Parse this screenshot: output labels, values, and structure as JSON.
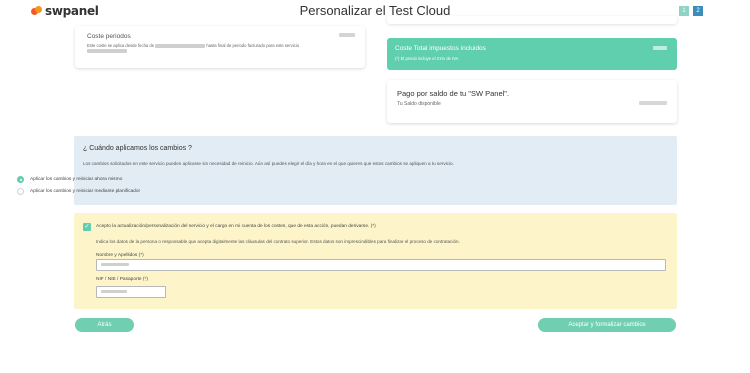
{
  "header": {
    "logo_text": "swpanel",
    "title": "Personalizar el Test Cloud",
    "steps": [
      "1",
      "2"
    ]
  },
  "coste": {
    "title": "Coste periodos",
    "desc_a": "Este coste se aplica desde fecha de",
    "desc_b": "hasta final de periodo facturado para este servicio"
  },
  "total": {
    "title": "Coste Total impuestos incluidos",
    "note": "(*) El precio incluye el 21% de IVA"
  },
  "pago": {
    "title": "Pago por saldo de tu \"SW Panel\".",
    "sub": "Tu Saldo disponible"
  },
  "cambios": {
    "title": "¿ Cuándo aplicamos los cambios ?",
    "desc": "Los cambios solicitados en este servicio pueden aplicarse sin necesidad de reinicio. Aún así puedes elegir el día y hora en el que quieres que estos cambios se apliquen a tu servicio.",
    "options": [
      {
        "label": "Aplicar los cambios y reiniciar ahora mismo",
        "selected": true
      },
      {
        "label": "Aplicar los cambios y reiniciar mediante planificador",
        "selected": false
      }
    ]
  },
  "accept": {
    "checkbox_checked": true,
    "check_mark": "✓",
    "text": "Acepto la actualización/personalización del servicio y el cargo en mi cuenta de los costes, que de esta acción, puedan derivarse. (*)",
    "indica": "Indica los datos de la persona o responsable que acepta digitalmente las cláusulas del contrato superior. Estos datos son imprescindibles para finalizar el proceso de contratación.",
    "name_label": "Nombre y Apellidos (*)",
    "nif_label": "NIF / NIE / Pasaporte (*)"
  },
  "buttons": {
    "back": "Atrás",
    "submit": "Aceptar y formalizar cambios"
  },
  "colors": {
    "accent": "#5fcfae",
    "panel_blue": "#e1ecf4",
    "panel_yellow": "#fdf5c9"
  }
}
